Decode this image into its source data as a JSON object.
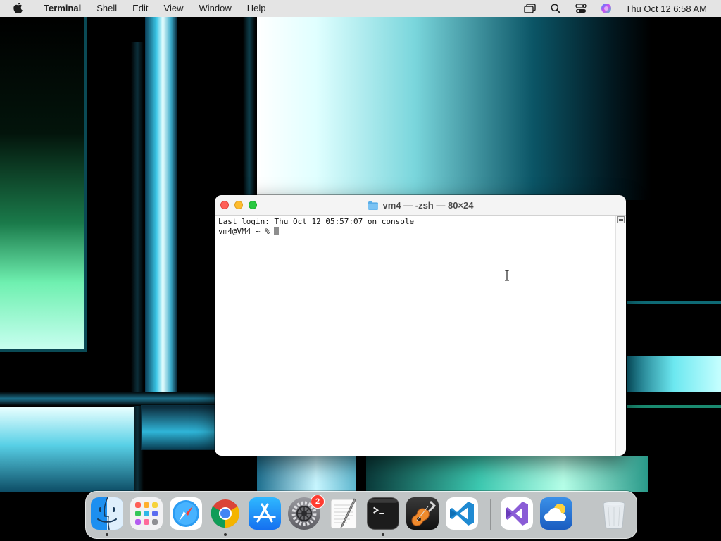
{
  "menubar": {
    "app_name": "Terminal",
    "items": [
      "Shell",
      "Edit",
      "View",
      "Window",
      "Help"
    ],
    "clock": "Thu Oct 12  6:58 AM"
  },
  "window": {
    "title": "vm4 — -zsh — 80×24",
    "lines": [
      "Last login: Thu Oct 12 05:57:07 on console"
    ],
    "prompt": "vm4@VM4 ~ % "
  },
  "dock": {
    "items": [
      {
        "name": "Finder",
        "icon": "finder-icon"
      },
      {
        "name": "Launchpad",
        "icon": "launchpad-icon"
      },
      {
        "name": "Safari",
        "icon": "safari-icon"
      },
      {
        "name": "Google Chrome",
        "icon": "chrome-icon"
      },
      {
        "name": "App Store",
        "icon": "app-store-icon"
      },
      {
        "name": "System Settings",
        "icon": "system-settings-icon"
      },
      {
        "name": "TextEdit",
        "icon": "textedit-icon"
      },
      {
        "name": "Terminal",
        "icon": "terminal-icon"
      },
      {
        "name": "GarageBand",
        "icon": "garageband-icon"
      },
      {
        "name": "Visual Studio Code",
        "icon": "vscode-icon"
      },
      {
        "name": "Visual Studio",
        "icon": "visual-studio-icon"
      },
      {
        "name": "Weather",
        "icon": "weather-icon"
      },
      {
        "name": "Trash",
        "icon": "trash-icon"
      }
    ],
    "settings_badge": "2"
  },
  "colors": {
    "menubar_bg": "#e4e4e4",
    "close": "#ff5f57",
    "minimize": "#febc2e",
    "maximize": "#28c840",
    "badge": "#ff3b30"
  }
}
